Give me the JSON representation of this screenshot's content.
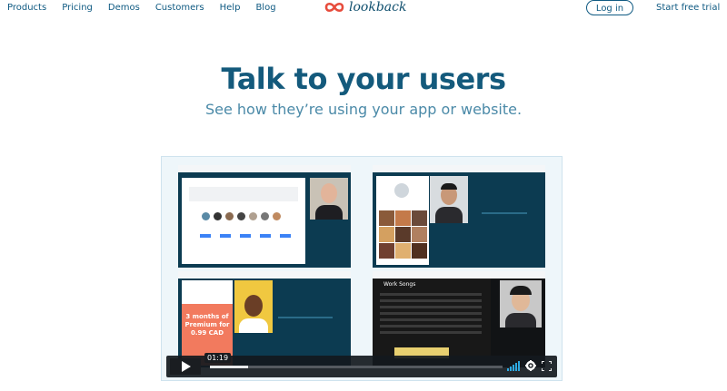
{
  "nav": {
    "links": [
      "Products",
      "Pricing",
      "Demos",
      "Customers",
      "Help",
      "Blog"
    ],
    "logo_text": "lookback",
    "login_label": "Log in",
    "trial_label": "Start free trial"
  },
  "hero": {
    "title": "Talk to your users",
    "subtitle": "See how they’re using your app or website."
  },
  "video": {
    "time": "01:19",
    "progress": 0.13,
    "promo_text": "3 months of Premium for 0.99 CAD",
    "music_title": "Work Songs"
  },
  "colors": {
    "brand": "#145a7c",
    "accent": "#e74c3c",
    "panel_bg": "#0c3b51",
    "volume": "#2ca9e1"
  }
}
